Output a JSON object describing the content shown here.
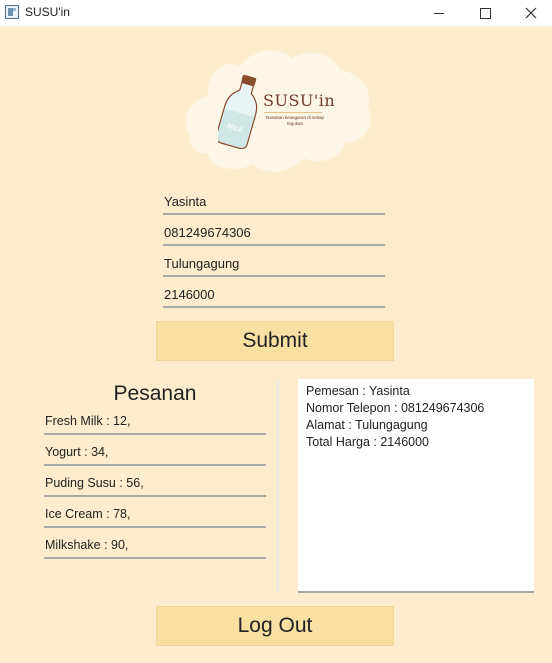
{
  "window": {
    "title": "SUSU'in",
    "controls": [
      "minimize",
      "maximize",
      "close"
    ]
  },
  "logo": {
    "brand": "SUSU'in",
    "tagline": "Rasakan kesegaran di setiap tegukan",
    "bottle_label": "MILK",
    "icon": "milk-bottle-icon"
  },
  "form": {
    "name": "Yasinta",
    "phone": "081249674306",
    "address": "Tulungagung",
    "total": "2146000",
    "submit_label": "Submit"
  },
  "orders": {
    "title": "Pesanan",
    "items": [
      "Fresh Milk : 12,",
      "Yogurt : 34,",
      "Puding Susu : 56,",
      "Ice Cream : 78,",
      "Milkshake : 90,"
    ]
  },
  "summary": {
    "lines": [
      "Pemesan : Yasinta",
      "Nomor Telepon : 081249674306",
      "Alamat : Tulungagung",
      "Total Harga : 2146000"
    ]
  },
  "logout_label": "Log Out",
  "colors": {
    "background": "#fdeccd",
    "button": "#f8dfa2",
    "logo_splash": "#fdf6e6",
    "brand_text": "#6e3c2b"
  }
}
